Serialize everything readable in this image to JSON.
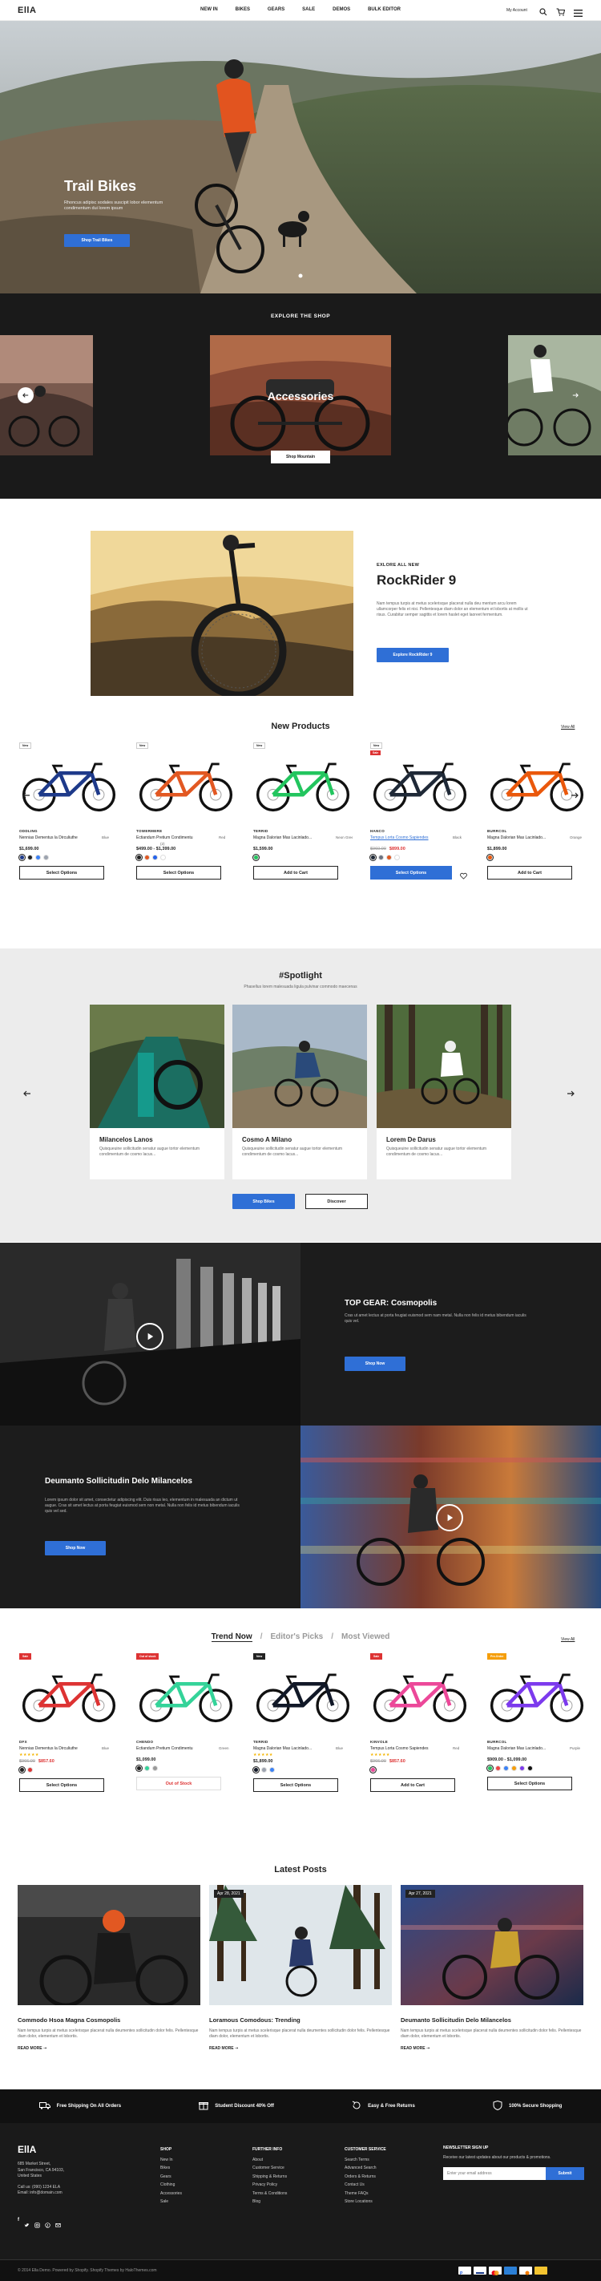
{
  "header": {
    "logo": "EllA",
    "nav": [
      "NEW IN",
      "BIKES",
      "GEARS",
      "SALE",
      "DEMOS",
      "BULK EDITOR"
    ],
    "account_label": "My Account"
  },
  "hero": {
    "title": "Trail Bikes",
    "subtitle": "Rhoncus adipisc sodales suscipit lobor elementum condimentum dui lorem ipsum",
    "button": "Shop Trail Bikes"
  },
  "explore": {
    "heading": "EXPLORE THE SHOP",
    "center_title": "Accessories",
    "center_button": "Shop Mountain"
  },
  "feature": {
    "kicker": "EXLORE ALL NEW",
    "title": "RockRider 9",
    "body": "Nam tempus turpis at metus scelerisque placerat nulla deu mentum arcu lorem ullamcorper felis et nisi. Pellentesque diam dolor an elementum et lobortis at mollis ut risus. Curabitur semper sagittis et lorem haslet eget laoreet fermentum.",
    "button": "Explore RockRider 9"
  },
  "new_products": {
    "heading": "New Products",
    "view_all": "View All",
    "items": [
      {
        "badge": "New",
        "sale": "",
        "brand": "ODDLING",
        "name": "Nennias Dementus la Dirculiuthe",
        "variant": "Blue",
        "old_price": "",
        "price": "$1,699.00",
        "reviews": "",
        "button": "Select Options",
        "frame": "#1e3a8a",
        "colors": [
          "#1e3a8a",
          "#222222",
          "#3b82f6",
          "#9ca3af"
        ],
        "btn_style": "outline"
      },
      {
        "badge": "New",
        "sale": "",
        "brand": "TOWERMERE",
        "name": "Ectiandum Pretium Condimentu",
        "variant": "Red",
        "old_price": "",
        "price": "$499.00 - $1,399.00",
        "reviews": "(2)",
        "button": "Select Options",
        "frame": "#e25822",
        "colors": [
          "#222222",
          "#e25822",
          "#2563eb",
          "#ffffff"
        ],
        "btn_style": "outline"
      },
      {
        "badge": "New",
        "sale": "",
        "brand": "TERRID",
        "name": "Magna Dalorian Mas Lacinlado...",
        "variant": "Neon Green",
        "old_price": "",
        "price": "$1,599.00",
        "reviews": "",
        "button": "Add to Cart",
        "frame": "#22c55e",
        "colors": [
          "#22c55e"
        ],
        "btn_style": "outline"
      },
      {
        "badge": "New",
        "sale": "Sale",
        "brand": "HANCO",
        "name": "Tempus Lorta Cosmo Sapiendes",
        "variant": "Black",
        "old_price": "$960.00",
        "price": "$899.00",
        "reviews": "",
        "button": "Select Options",
        "frame": "#1f2937",
        "colors": [
          "#1f2937",
          "#6b7280",
          "#e25822",
          "#ffffff"
        ],
        "btn_style": "blue"
      },
      {
        "badge": "",
        "sale": "",
        "brand": "BURRCOL",
        "name": "Magna Dalorian Mas Lacinlado...",
        "variant": "Orange",
        "old_price": "",
        "price": "$1,899.00",
        "reviews": "",
        "button": "Add to Cart",
        "frame": "#ea580c",
        "colors": [
          "#ea580c"
        ],
        "btn_style": "outline"
      }
    ]
  },
  "spotlight": {
    "heading": "#Spotlight",
    "subheading": "Phasellus lorem malesuada ligula pulvinar commodo maecenas",
    "cards": [
      {
        "title": "Milancelos Lanos",
        "body": "Quisqueuine sollicitudin senatur augue tortor elementum condimentum de cosmo lacus..."
      },
      {
        "title": "Cosmo A Milano",
        "body": "Quisqueuine sollicitudin senatur augue tortor elementum condimentum de cosmo lacus..."
      },
      {
        "title": "Lorem De Darus",
        "body": "Quisqueuine sollicitudin senatur augue tortor elementum condimentum de cosmo lacus..."
      }
    ],
    "button_primary": "Shop Bikes",
    "button_secondary": "Discover"
  },
  "promo1": {
    "title": "TOP GEAR: Cosmopolis",
    "body": "Cras ut amet lectus at porta feugiat euismod sem nam metal. Nulla non felis id metus bibendum iaculis quis vel.",
    "button": "Shop Now"
  },
  "promo2": {
    "title": "Deumanto Sollicitudin Delo Milancelos",
    "body": "Lorem ipsum dolor sit amet, consectetur adipiscing elit. Duis risus leo, elementum in malesuada an dictum ut augue. Cras sit amet lectus at porta feugiat euismod sem non metal. Nulla non felis id metus bibendum iaculis quis vel sed.",
    "button": "Shop Now"
  },
  "trend": {
    "tabs": [
      "Trend Now",
      "Editor's Picks",
      "Most Viewed"
    ],
    "separator": "/",
    "view_all": "View All",
    "items": [
      {
        "badge": "Sale",
        "badge_color": "#d33",
        "brand": "DFX",
        "name": "Nennias Dementus la Dirculiuthe",
        "variant": "Blue",
        "old_price": "$966.00",
        "price": "$857.60",
        "stars": "★★★★★",
        "reviews": "",
        "button": "Select Options",
        "frame": "#d33",
        "colors": [
          "#222222",
          "#d33"
        ],
        "btn_style": "outline",
        "accent": "#d33"
      },
      {
        "badge": "Out of stock",
        "badge_color": "#d33",
        "brand": "CHENDO",
        "name": "Ectiandum Pretium Condimentu",
        "variant": "Green",
        "old_price": "",
        "price": "$1,099.00",
        "stars": "",
        "reviews": "",
        "button": "Out of Stock",
        "frame": "#34d399",
        "colors": [
          "#222222",
          "#34d399",
          "#999999"
        ],
        "btn_style": "disabled",
        "accent": "#222"
      },
      {
        "badge": "New",
        "badge_color": "#222",
        "brand": "TERRID",
        "name": "Magna Dalorian Mas Lacinlado...",
        "variant": "Blue",
        "old_price": "",
        "price": "$1,899.00",
        "stars": "★★★★★",
        "reviews": "",
        "button": "Select Options",
        "frame": "#111827",
        "colors": [
          "#111827",
          "#9ca3af",
          "#3b82f6"
        ],
        "btn_style": "outline",
        "accent": "#222"
      },
      {
        "badge": "Sale",
        "badge_color": "#d33",
        "brand": "KINVOLE",
        "name": "Tempus Lorta Cosmo Sapiendes",
        "variant": "Red",
        "old_price": "$966.00",
        "price": "$857.60",
        "stars": "★★★★★",
        "reviews": "",
        "button": "Add to Cart",
        "frame": "#ec4899",
        "colors": [
          "#ec4899"
        ],
        "btn_style": "outline",
        "accent": "#d33"
      },
      {
        "badge": "Pre-Order",
        "badge_color": "#f59e0b",
        "brand": "BURRCOL",
        "name": "Magna Dalorian Mas Lacinlado...",
        "variant": "Purple",
        "old_price": "",
        "price": "$909.00 - $1,099.00",
        "stars": "",
        "reviews": "",
        "button": "Select Options",
        "frame": "#7c3aed",
        "colors": [
          "#22c55e",
          "#ef4444",
          "#3b82f6",
          "#f59e0b",
          "#7c3aed",
          "#111111"
        ],
        "btn_style": "outline",
        "accent": "#222"
      }
    ]
  },
  "posts": {
    "heading": "Latest Posts",
    "items": [
      {
        "date": "",
        "title": "Commodo Hsoa Magna Cosmopolis",
        "body": "Nam tempus turpis at metus scelerisque placerat nulla deumentes sollicitudin dolor felis. Pellentesque diam dolor, elementum et lobortis.",
        "more": "READ MORE"
      },
      {
        "date": "Apr 28, 2021",
        "title": "Loramous Comodous: Trending",
        "body": "Nam tempus turpis at metus scelerisque placerat nulla deumentes sollicitudin dolor felis. Pellentesque diam dolor, elementum et lobortis.",
        "more": "READ MORE"
      },
      {
        "date": "Apr 27, 2021",
        "title": "Deumanto Sollicitudin Delo Milancelos",
        "body": "Nam tempus turpis at metus scelerisque placerat nulla deumentes sollicitudin dolor felis. Pellentesque diam dolor, elementum et lobortis.",
        "more": "READ MORE"
      }
    ]
  },
  "features_bar": [
    "Free Shipping On All Orders",
    "Student Discount 40% Off",
    "Easy & Free Returns",
    "100% Secure Shopping"
  ],
  "footer": {
    "logo": "EllA",
    "address": [
      "685 Market Street,",
      "San Francisco, CA 94103,",
      "United States"
    ],
    "phone": "Call us: (090) 1234 ELA",
    "email": "Email: info@domain.com",
    "columns": [
      {
        "title": "SHOP",
        "links": [
          "New In",
          "Bikes",
          "Gears",
          "Clothing",
          "Accessories",
          "Sale"
        ]
      },
      {
        "title": "FURTHER INFO",
        "links": [
          "About",
          "Customer Service",
          "Shipping & Returns",
          "Privacy Policy",
          "Terms & Conditions",
          "Blog"
        ]
      },
      {
        "title": "CUSTOMER SERVICE",
        "links": [
          "Search Terms",
          "Advanced Search",
          "Orders & Returns",
          "Contact Us",
          "Theme FAQs",
          "Store Locations"
        ]
      }
    ],
    "newsletter": {
      "title": "NEWSLETTER SIGN UP",
      "text": "Receive our latest updates about our products & promotions.",
      "placeholder": "Enter your email address",
      "button": "Submit"
    },
    "copyright": "© 2014 Ella Demo. Powered by Shopify. Shopify Themes by HaloThemes.com"
  }
}
